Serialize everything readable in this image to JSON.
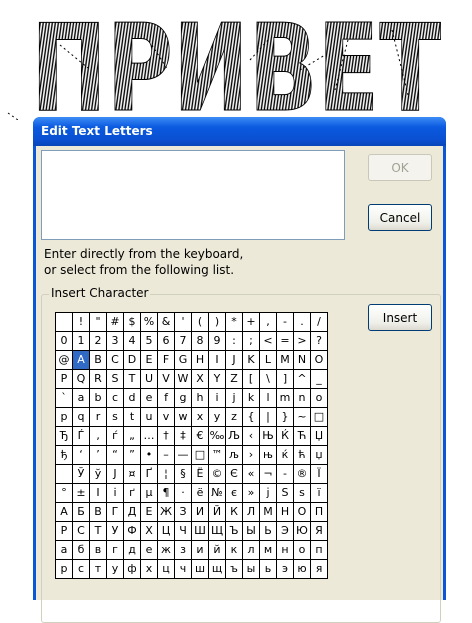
{
  "banner": {
    "text": "ПРИВЕТ"
  },
  "dialog": {
    "title": "Edit Text Letters",
    "ok_label": "OK",
    "cancel_label": "Cancel",
    "insert_label": "Insert",
    "hint_line1": "Enter directly from the keyboard,",
    "hint_line2": "or select from the following list.",
    "group_label": "Insert Character",
    "text_value": "",
    "selected_char": "A"
  },
  "charmap": [
    [
      " ",
      "!",
      "\"",
      "#",
      "$",
      "%",
      "&",
      "'",
      "(",
      ")",
      "*",
      "+",
      ",",
      "-",
      ".",
      "/"
    ],
    [
      "0",
      "1",
      "2",
      "3",
      "4",
      "5",
      "6",
      "7",
      "8",
      "9",
      ":",
      ";",
      "<",
      "=",
      ">",
      "?"
    ],
    [
      "@",
      "A",
      "B",
      "C",
      "D",
      "E",
      "F",
      "G",
      "H",
      "I",
      "J",
      "K",
      "L",
      "M",
      "N",
      "O"
    ],
    [
      "P",
      "Q",
      "R",
      "S",
      "T",
      "U",
      "V",
      "W",
      "X",
      "Y",
      "Z",
      "[",
      "\\",
      "]",
      "^",
      "_"
    ],
    [
      "`",
      "a",
      "b",
      "c",
      "d",
      "e",
      "f",
      "g",
      "h",
      "i",
      "j",
      "k",
      "l",
      "m",
      "n",
      "o"
    ],
    [
      "p",
      "q",
      "r",
      "s",
      "t",
      "u",
      "v",
      "w",
      "x",
      "y",
      "z",
      "{",
      "|",
      "}",
      "~",
      "□"
    ],
    [
      "Ђ",
      "Ѓ",
      "‚",
      "ѓ",
      "„",
      "…",
      "†",
      "‡",
      "€",
      "‰",
      "Љ",
      "‹",
      "Њ",
      "Ќ",
      "Ћ",
      "Џ"
    ],
    [
      "ђ",
      "‘",
      "’",
      "“",
      "”",
      "•",
      "–",
      "—",
      "□",
      "™",
      "љ",
      "›",
      "њ",
      "ќ",
      "ћ",
      "џ"
    ],
    [
      " ",
      "Ў",
      "ў",
      "Ј",
      "¤",
      "Ґ",
      "¦",
      "§",
      "Ё",
      "©",
      "Є",
      "«",
      "¬",
      "-",
      "®",
      "Ї"
    ],
    [
      "°",
      "±",
      "І",
      "і",
      "ґ",
      "µ",
      "¶",
      "·",
      "ё",
      "№",
      "є",
      "»",
      "ј",
      "Ѕ",
      "ѕ",
      "ї"
    ],
    [
      "А",
      "Б",
      "В",
      "Г",
      "Д",
      "Е",
      "Ж",
      "З",
      "И",
      "Й",
      "К",
      "Л",
      "М",
      "Н",
      "О",
      "П"
    ],
    [
      "Р",
      "С",
      "Т",
      "У",
      "Ф",
      "Х",
      "Ц",
      "Ч",
      "Ш",
      "Щ",
      "Ъ",
      "Ы",
      "Ь",
      "Э",
      "Ю",
      "Я"
    ],
    [
      "а",
      "б",
      "в",
      "г",
      "д",
      "е",
      "ж",
      "з",
      "и",
      "й",
      "к",
      "л",
      "м",
      "н",
      "о",
      "п"
    ],
    [
      "р",
      "с",
      "т",
      "у",
      "ф",
      "х",
      "ц",
      "ч",
      "ш",
      "щ",
      "ъ",
      "ы",
      "ь",
      "э",
      "ю",
      "я"
    ]
  ]
}
